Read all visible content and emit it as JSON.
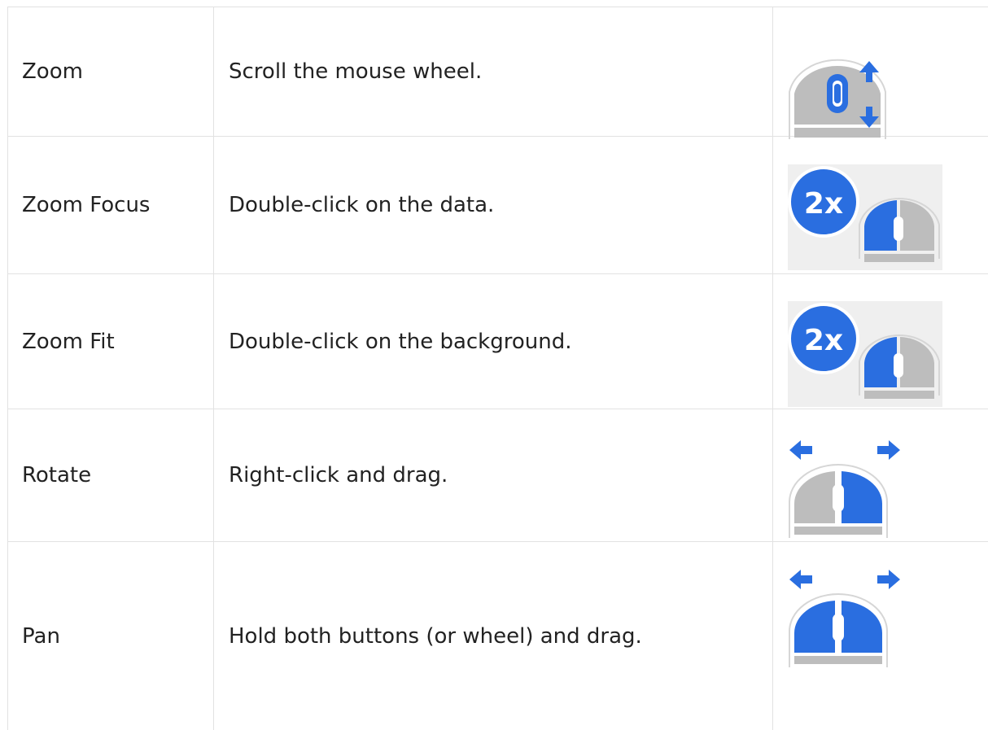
{
  "rows": [
    {
      "action": "Zoom",
      "description": "Scroll the mouse wheel.",
      "icon": "mouse-scroll-wheel-icon"
    },
    {
      "action": "Zoom Focus",
      "description": "Double-click on the data.",
      "icon": "mouse-double-click-icon"
    },
    {
      "action": "Zoom Fit",
      "description": "Double-click on the background.",
      "icon": "mouse-double-click-icon"
    },
    {
      "action": "Rotate",
      "description": "Right-click and drag.",
      "icon": "mouse-right-drag-icon"
    },
    {
      "action": "Pan",
      "description": "Hold both buttons (or wheel) and drag.",
      "icon": "mouse-both-buttons-drag-icon"
    }
  ],
  "icon_text": {
    "double_click": "2x"
  },
  "colors": {
    "accent_blue": "#2a6ee0",
    "mouse_gray": "#bdbdbd",
    "icon_bg": "#efefef",
    "grid_line": "#e2e2e2",
    "text": "#222222"
  }
}
